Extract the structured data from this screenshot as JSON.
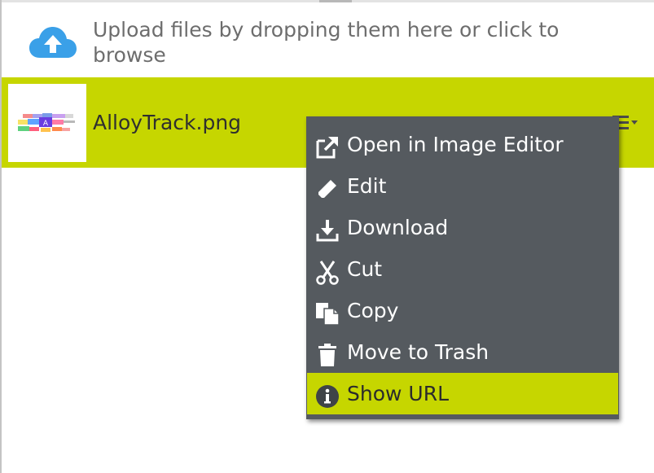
{
  "upload": {
    "text": "Upload files by dropping them here or click to browse",
    "icon": "cloud-upload-icon",
    "icon_color": "#3aa0e8"
  },
  "file": {
    "name": "AlloyTrack.png",
    "row_color": "#c6d600",
    "menu_icon": "hamburger-dropdown-icon"
  },
  "context_menu": {
    "background": "#555a5f",
    "items": [
      {
        "label": "Open in Image Editor",
        "icon": "external-link-icon"
      },
      {
        "label": "Edit",
        "icon": "pencil-icon"
      },
      {
        "label": "Download",
        "icon": "download-icon"
      },
      {
        "label": "Cut",
        "icon": "scissors-icon"
      },
      {
        "label": "Copy",
        "icon": "copy-icon"
      },
      {
        "label": "Move to Trash",
        "icon": "trash-icon"
      },
      {
        "label": "Show URL",
        "icon": "info-icon",
        "highlighted": true
      }
    ]
  }
}
